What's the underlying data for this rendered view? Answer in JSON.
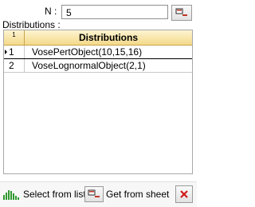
{
  "form": {
    "n_label": "N :",
    "n_value": "5",
    "distributions_label": "Distributions :"
  },
  "grid": {
    "index_header": "1",
    "name_header": "Distributions",
    "rows": [
      {
        "index": "1",
        "name": "VosePertObject(10,15,16)",
        "selected": true
      },
      {
        "index": "2",
        "name": "VoseLognormalObject(2,1)",
        "selected": false
      }
    ]
  },
  "footer": {
    "select_label": "Select from list",
    "sheet_label": "Get from sheet"
  },
  "icons": {
    "get_from_sheet": "range-select-icon",
    "select_from_list": "histogram-icon",
    "close": "close-x-icon"
  },
  "colors": {
    "header_top": "#fdf4d3",
    "header_bottom": "#f4d98a",
    "histogram_green": "#2e9a2e",
    "close_red": "#d11a1a"
  }
}
